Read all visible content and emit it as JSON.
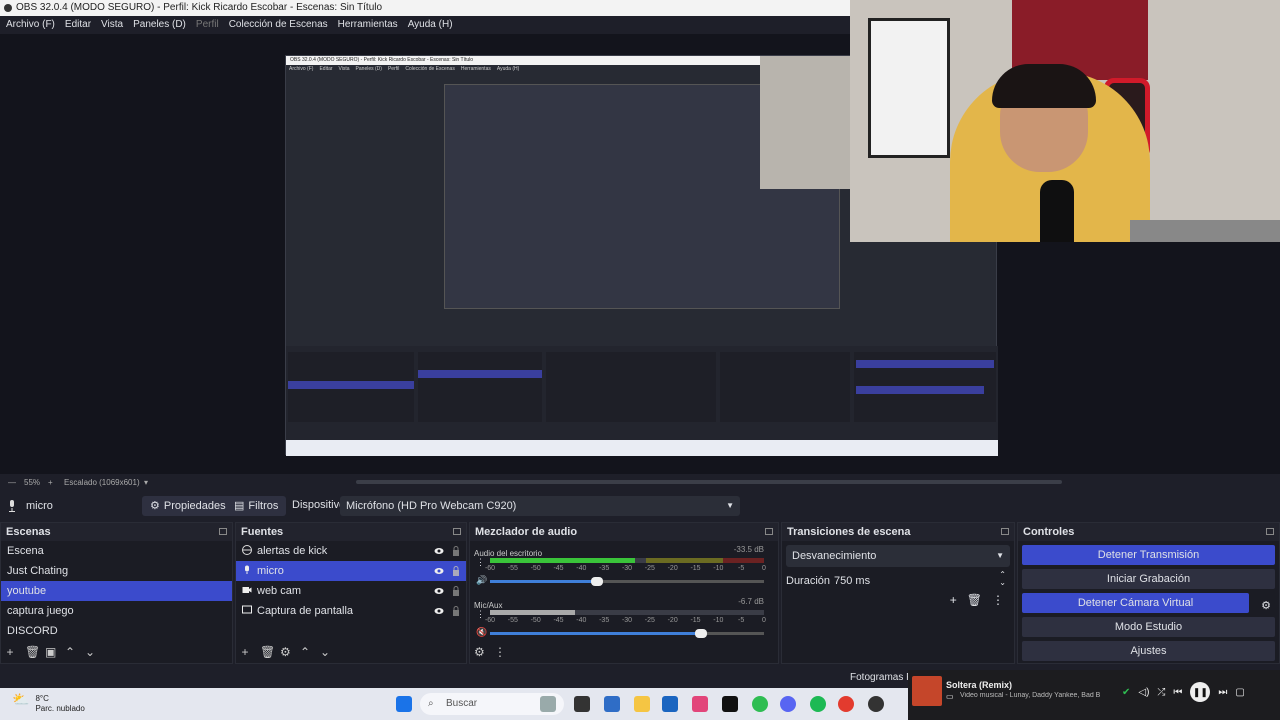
{
  "window": {
    "title": "OBS 32.0.4 (MODO SEGURO) - Perfil: Kick Ricardo Escobar - Escenas: Sin Título"
  },
  "menu": {
    "items": [
      "Archivo (F)",
      "Editar",
      "Vista",
      "Paneles (D)",
      "Perfil",
      "Colección de Escenas",
      "Herramientas",
      "Ayuda (H)"
    ]
  },
  "nested": {
    "title": "OBS 32.0.4 (MODO SEGURO) - Perfil: Kick Ricardo Escobar - Escenas: Sin Título",
    "menu": [
      "Archivo (F)",
      "Editar",
      "Vista",
      "Paneles (D)",
      "Perfil",
      "Colección de Escenas",
      "Herramientas",
      "Ayuda (H)"
    ]
  },
  "status": {
    "zoom": "55%",
    "scale": "Escalado (1069x601)"
  },
  "source_bar": {
    "source_name": "micro",
    "properties_label": "Propiedades",
    "filters_label": "Filtros",
    "device_label": "Dispositivo",
    "device_value": "Micrófono (HD Pro Webcam C920)"
  },
  "scenes": {
    "title": "Escenas",
    "items": [
      "Escena",
      "Just Chating",
      "youtube",
      "captura juego",
      "DISCORD"
    ],
    "selected": 2
  },
  "sources": {
    "title": "Fuentes",
    "items": [
      {
        "label": "alertas de kick",
        "icon": "browser-icon"
      },
      {
        "label": "micro",
        "icon": "microphone-icon"
      },
      {
        "label": "web cam",
        "icon": "camera-icon"
      },
      {
        "label": "Captura de pantalla",
        "icon": "monitor-icon"
      }
    ],
    "selected": 1
  },
  "mixer": {
    "title": "Mezclador de audio",
    "channels": [
      {
        "name": "Audio del escritorio",
        "db": "-33.5 dB",
        "volume": 0.39,
        "level": 0.53
      },
      {
        "name": "Mic/Aux",
        "db": "-6.7 dB",
        "volume": 0.77,
        "level": 0.31
      }
    ],
    "ticks": [
      "-60",
      "-55",
      "-50",
      "-45",
      "-40",
      "-35",
      "-30",
      "-25",
      "-20",
      "-15",
      "-10",
      "-5",
      "0"
    ]
  },
  "transitions": {
    "title": "Transiciones de escena",
    "type": "Desvanecimiento",
    "duration_label": "Duración",
    "duration_value": "750 ms"
  },
  "controls": {
    "title": "Controles",
    "buttons": [
      "Detener Transmisión",
      "Iniciar Grabación",
      "Detener Cámara Virtual",
      "Modo Estudio",
      "Ajustes"
    ]
  },
  "footer": {
    "fps_label": "Fotogramas Pe"
  },
  "taskbar": {
    "weather_temp": "8°C",
    "weather_desc": "Parc. nublado",
    "search_placeholder": "Buscar"
  },
  "media": {
    "title": "Soltera (Remix)",
    "subtitle": "Video musical - Lunay, Daddy Yankee, Bad B"
  },
  "colors": {
    "accent": "#3b4bcc",
    "bg": "#1e1f29",
    "panel": "#1b1c24"
  }
}
